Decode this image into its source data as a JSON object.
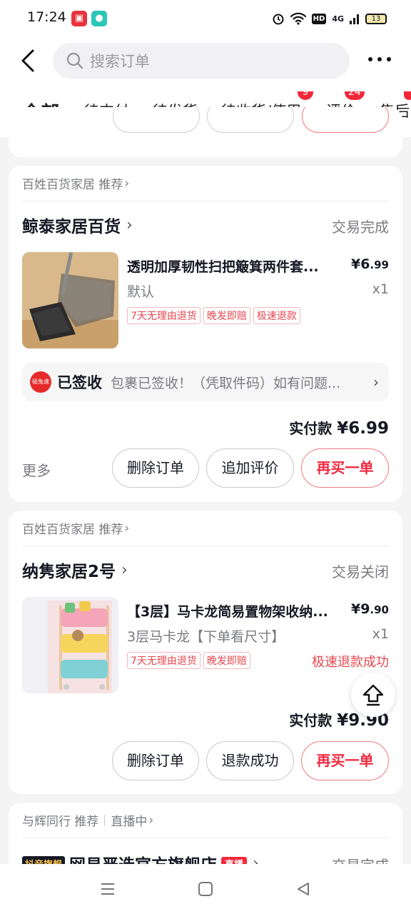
{
  "status_bar": {
    "time": "17:24",
    "app_icon_1": "shop-icon",
    "app_icon_2": "chat-icon",
    "hd": "HD",
    "network": "4G",
    "battery": "13"
  },
  "header": {
    "search_placeholder": "搜索订单"
  },
  "tabs": [
    {
      "label": "全部",
      "active": true
    },
    {
      "label": "待支付"
    },
    {
      "label": "待发货"
    },
    {
      "label": "待收货/使用",
      "badge": "9"
    },
    {
      "label": "评价",
      "badge": "24"
    },
    {
      "label": "售后"
    }
  ],
  "orders": [
    {
      "recommend": "百姓百货家居 推荐",
      "shop": "鲸泰家居百货",
      "status": "交易完成",
      "product_title": "透明加厚韧性扫把簸箕两件套...",
      "price_symbol": "¥",
      "price_int": "6",
      "price_dec": ".99",
      "spec": "默认",
      "qty": "x1",
      "tags": [
        "7天无理由退货",
        "晚发即赔",
        "极速退款"
      ],
      "logistics": {
        "logo": "极兔速递",
        "title": "已签收",
        "desc": "包裹已签收！（凭取件码）如有问题..."
      },
      "paid_label": "实付款",
      "paid_amount": "¥6.99",
      "more": "更多",
      "buttons": [
        "删除订单",
        "追加评价",
        "再买一单"
      ]
    },
    {
      "recommend": "百姓百货家居 推荐",
      "shop": "纳隽家居2号",
      "status": "交易关闭",
      "product_title": "【3层】马卡龙简易置物架收纳...",
      "price_symbol": "¥",
      "price_int": "9",
      "price_dec": ".90",
      "spec": "3层马卡龙【下单看尺寸】",
      "qty": "x1",
      "tags": [
        "7天无理由退货",
        "晚发即赔"
      ],
      "refund_status": "极速退款成功",
      "paid_label": "实付款",
      "paid_amount": "¥9.90",
      "buttons": [
        "删除订单",
        "退款成功",
        "再买一单"
      ]
    },
    {
      "recommend": "与辉同行 推荐",
      "live": "直播中",
      "brand_badge": "抖音旗舰",
      "shop": "网易严选官方旗舰店",
      "live_badge": "直播",
      "status": "交易完成"
    }
  ]
}
